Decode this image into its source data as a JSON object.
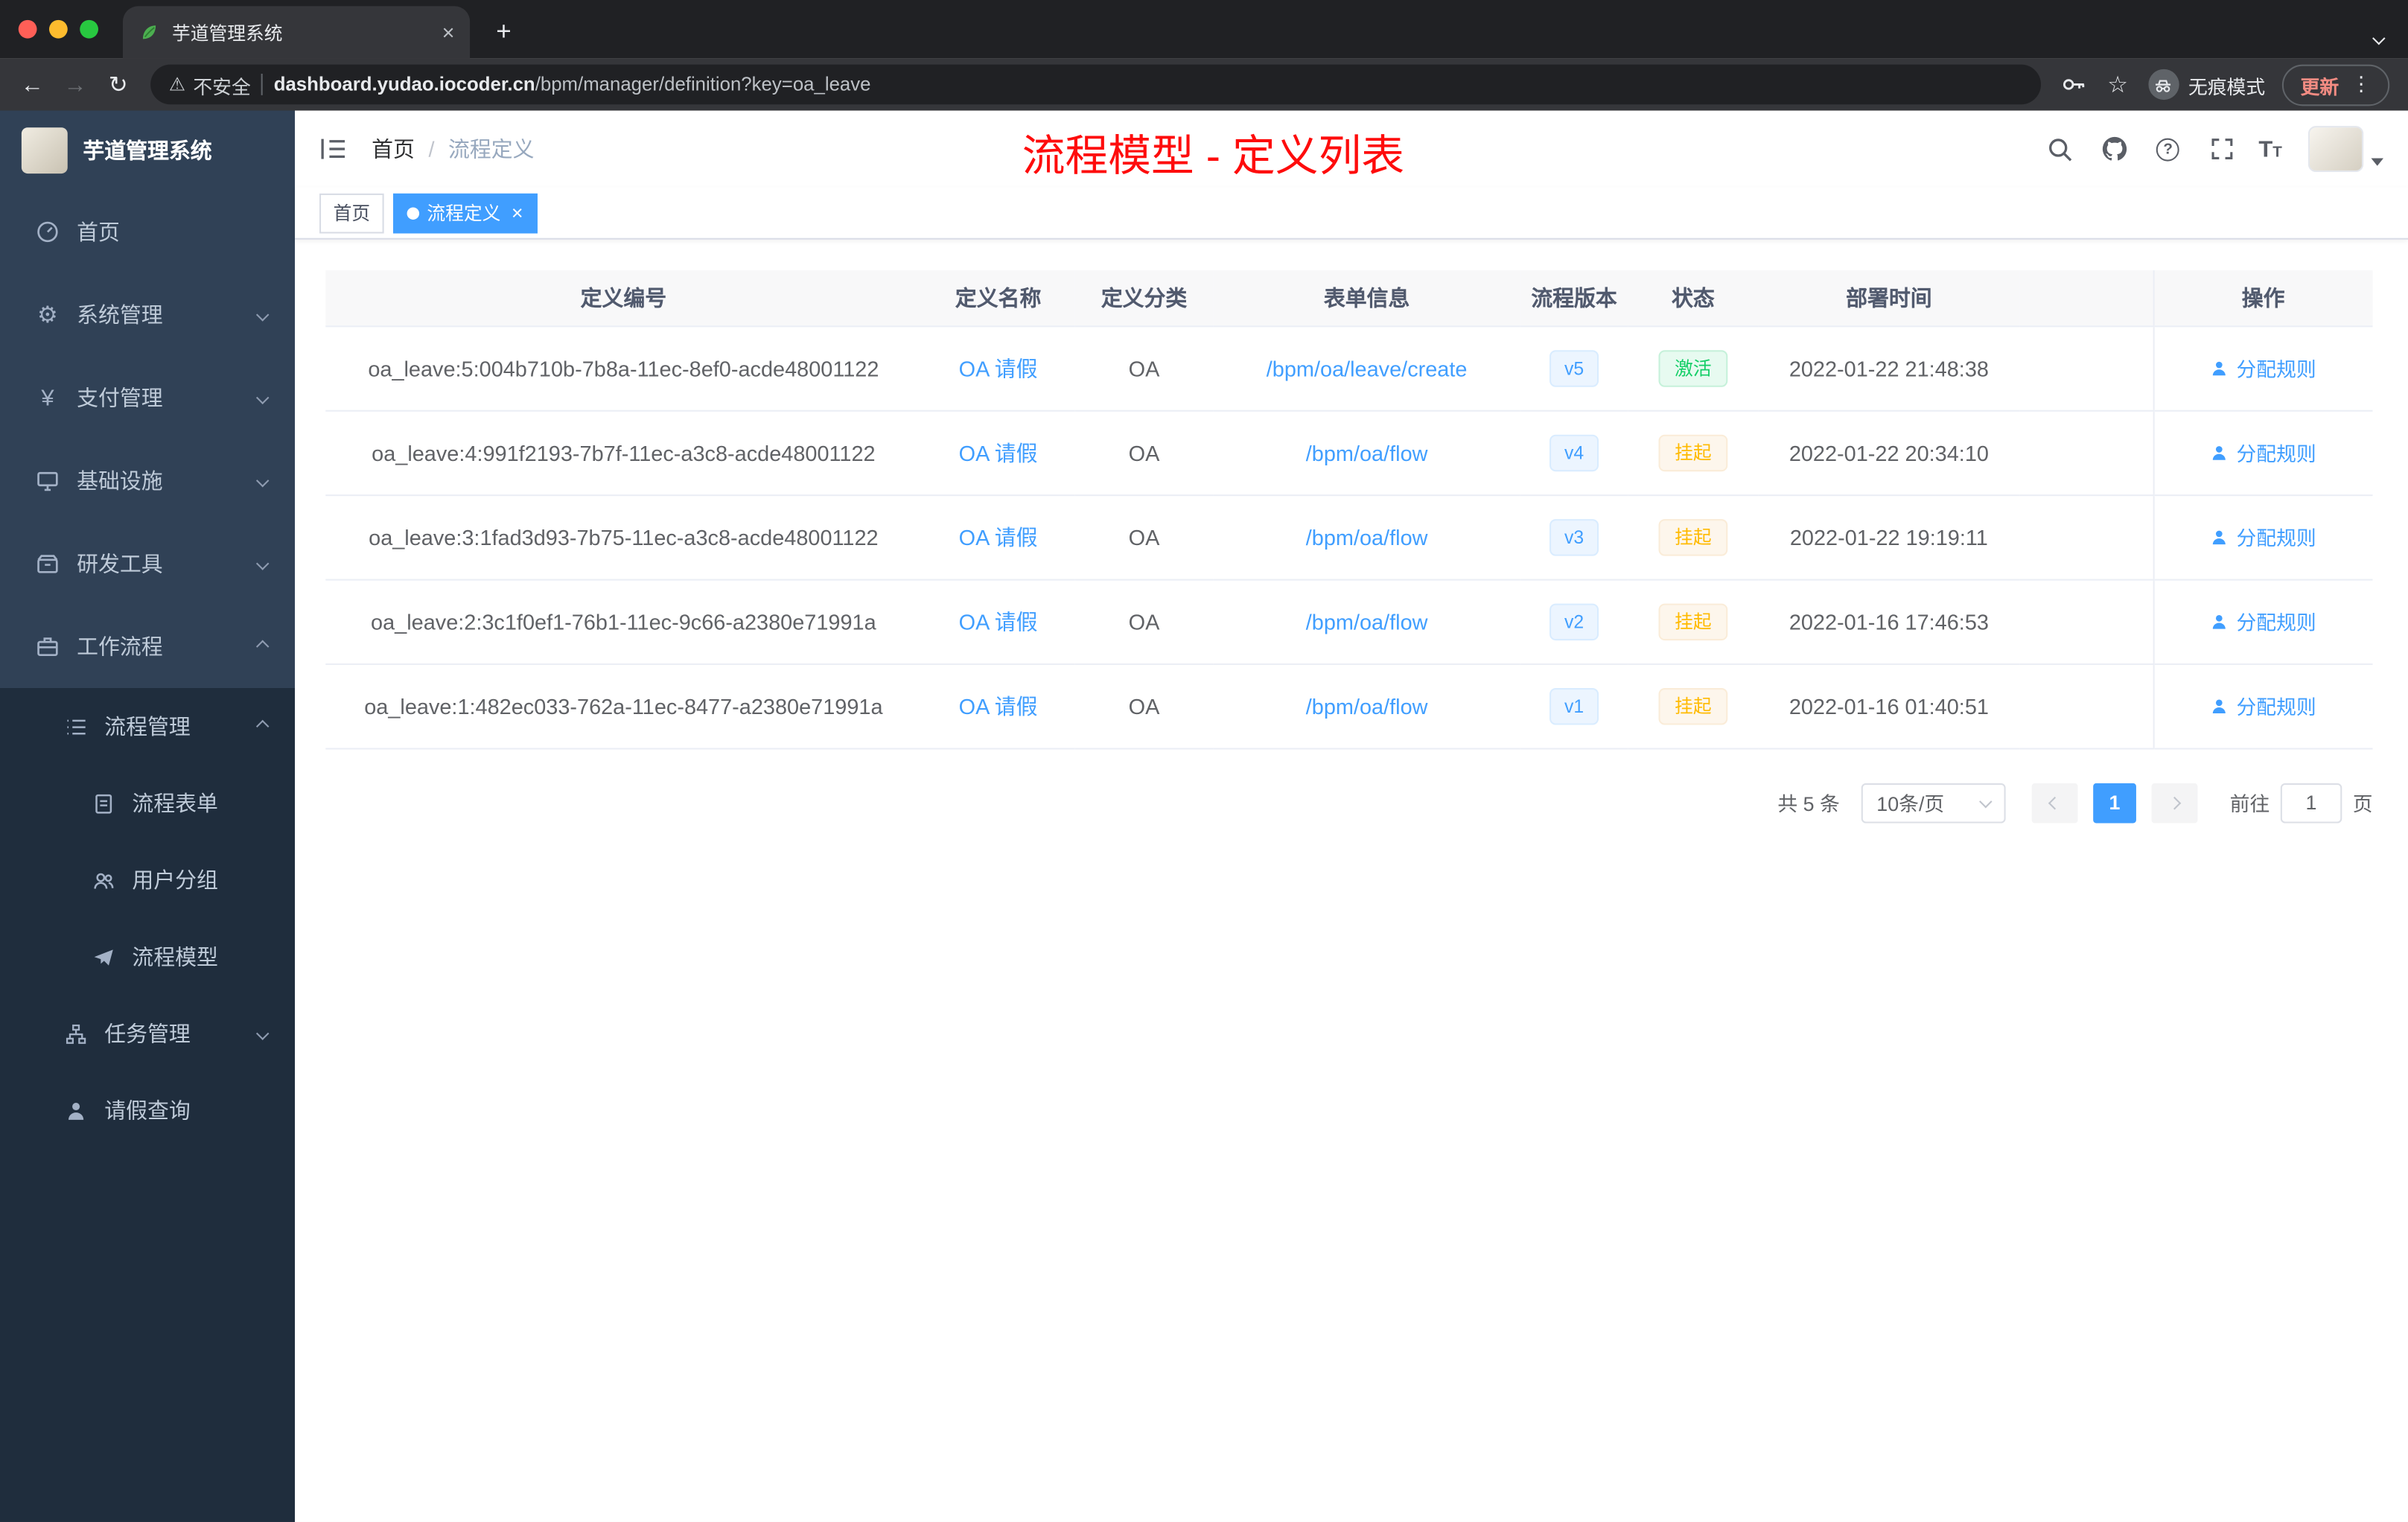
{
  "browser": {
    "tab_title": "芋道管理系统",
    "security_label": "不安全",
    "url_domain": "dashboard.yudao.iocoder.cn",
    "url_path": "/bpm/manager/definition?key=oa_leave",
    "incognito_label": "无痕模式",
    "update_label": "更新"
  },
  "glyphs": {
    "back": "←",
    "forward": "→",
    "reload": "↻",
    "warning": "⚠",
    "star": "☆",
    "more": "⋮",
    "plus": "+",
    "close": "×",
    "question": "?",
    "slash": "/",
    "yen": "¥",
    "gear": "⚙",
    "font_big": "T",
    "font_small": "T"
  },
  "sidebar": {
    "logo_title": "芋道管理系统",
    "items": [
      "首页",
      "系统管理",
      "支付管理",
      "基础设施",
      "研发工具",
      "工作流程",
      "流程管理",
      "流程表单",
      "用户分组",
      "流程模型",
      "任务管理",
      "请假查询"
    ]
  },
  "header": {
    "breadcrumb_home": "首页",
    "breadcrumb_current": "流程定义",
    "annotation": "流程模型 - 定义列表"
  },
  "tags": {
    "home": "首页",
    "active": "流程定义"
  },
  "table": {
    "columns": [
      "定义编号",
      "定义名称",
      "定义分类",
      "表单信息",
      "流程版本",
      "状态",
      "部署时间",
      "操作"
    ],
    "rows": [
      {
        "id": "oa_leave:5:004b710b-7b8a-11ec-8ef0-acde48001122",
        "name": "OA 请假",
        "category": "OA",
        "form": "/bpm/oa/leave/create",
        "version": "v5",
        "status": "激活",
        "time": "2022-01-22 21:48:38",
        "action": "分配规则"
      },
      {
        "id": "oa_leave:4:991f2193-7b7f-11ec-a3c8-acde48001122",
        "name": "OA 请假",
        "category": "OA",
        "form": "/bpm/oa/flow",
        "version": "v4",
        "status": "挂起",
        "time": "2022-01-22 20:34:10",
        "action": "分配规则"
      },
      {
        "id": "oa_leave:3:1fad3d93-7b75-11ec-a3c8-acde48001122",
        "name": "OA 请假",
        "category": "OA",
        "form": "/bpm/oa/flow",
        "version": "v3",
        "status": "挂起",
        "time": "2022-01-22 19:19:11",
        "action": "分配规则"
      },
      {
        "id": "oa_leave:2:3c1f0ef1-76b1-11ec-9c66-a2380e71991a",
        "name": "OA 请假",
        "category": "OA",
        "form": "/bpm/oa/flow",
        "version": "v2",
        "status": "挂起",
        "time": "2022-01-16 17:46:53",
        "action": "分配规则"
      },
      {
        "id": "oa_leave:1:482ec033-762a-11ec-8477-a2380e71991a",
        "name": "OA 请假",
        "category": "OA",
        "form": "/bpm/oa/flow",
        "version": "v1",
        "status": "挂起",
        "time": "2022-01-16 01:40:51",
        "action": "分配规则"
      }
    ]
  },
  "pagination": {
    "total": "共 5 条",
    "page_size": "10条/页",
    "current_page": "1",
    "goto_label": "前往",
    "goto_value": "1",
    "page_unit": "页"
  },
  "colors": {
    "accent": "#409eff",
    "annotation_red": "#fe0c0c",
    "sidebar_bg": "#304156",
    "submenu_bg": "#1f2d3d",
    "success": "#13ce66",
    "warning": "#ffba00"
  }
}
